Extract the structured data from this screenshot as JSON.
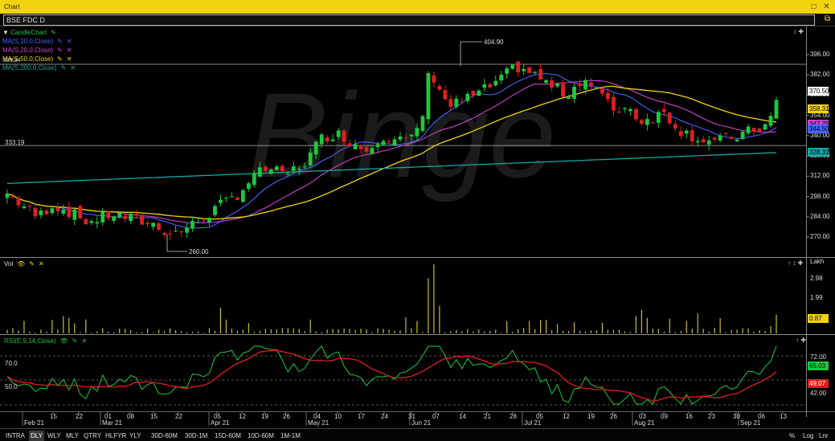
{
  "window": {
    "title": "Chart",
    "symbol": "BSE FDC D"
  },
  "watermark": "Binge",
  "price_pane": {
    "legend": [
      {
        "label": "CandleChart",
        "color": "#1ec83c"
      },
      {
        "label": "MA(S,10.0,Close)",
        "color": "#4466ff"
      },
      {
        "label": "MA(S,20.0,Close)",
        "color": "#cc44cc"
      },
      {
        "label": "MA(S,50.0,Close)",
        "color": "#f1d40b"
      },
      {
        "label": "MA(S,200.0,Close)",
        "color": "#1aa5a5"
      }
    ],
    "y_ticks": [
      "396.00",
      "382.00",
      "368.00",
      "354.00",
      "340.00",
      "326.00",
      "312.00",
      "298.00",
      "284.00",
      "270.00"
    ],
    "left_levels": [
      "389.34",
      "333.19"
    ],
    "annotations": {
      "high": "404.90",
      "low": "260.00"
    },
    "tags": [
      {
        "text": "370.50",
        "bg": "#ffffff",
        "fg": "#000000"
      },
      {
        "text": "358.31",
        "bg": "#f1d40b",
        "fg": "#000000"
      },
      {
        "text": "347.75",
        "bg": "#cc44cc",
        "fg": "#000000"
      },
      {
        "text": "344.50",
        "bg": "#4466ff",
        "fg": "#000000"
      },
      {
        "text": "328.31",
        "bg": "#1aa5a5",
        "fg": "#000000"
      }
    ]
  },
  "volume_pane": {
    "legend": "Vol",
    "unit": "Lakh",
    "y_ticks": [
      "2.98",
      "1.99"
    ],
    "tag": "0.87"
  },
  "rsi_pane": {
    "legend": "RSI(E,9,14,Close)",
    "y_ticks": [
      "72.00",
      "42.00"
    ],
    "left_levels": [
      "70.0",
      "50.0"
    ],
    "tags": [
      {
        "text": "65.03",
        "bg": "#1ec83c",
        "fg": "#000000"
      },
      {
        "text": "49.07",
        "bg": "#e0201e",
        "fg": "#ffffff"
      }
    ]
  },
  "x_axis": {
    "days": [
      "15",
      "22",
      "01",
      "08",
      "15",
      "22",
      "05",
      "12",
      "19",
      "26",
      "04",
      "10",
      "17",
      "24",
      "31",
      "07",
      "14",
      "21",
      "28",
      "05",
      "12",
      "19",
      "26",
      "03",
      "09",
      "16",
      "23",
      "30",
      "06",
      "13"
    ],
    "months": [
      "Feb 21",
      "Mar 21",
      "Apr 21",
      "May 21",
      "Jun 21",
      "Jul 21",
      "Aug 21",
      "Sep 21"
    ]
  },
  "bottom_bar": {
    "periods": [
      "INTRA",
      "DLY",
      "WLY",
      "MLY",
      "QTRY",
      "HLFYR",
      "YLY"
    ],
    "selected": "DLY",
    "intervals": [
      "30D-60M",
      "30D-1M",
      "15D-60M",
      "10D-60M",
      "1M-1M"
    ],
    "right": [
      "%",
      "Log",
      "Lnr"
    ]
  },
  "colors": {
    "up": "#1ec83c",
    "down": "#e0201e",
    "accent": "#f1d40b",
    "volume": "#c9c02a"
  }
}
